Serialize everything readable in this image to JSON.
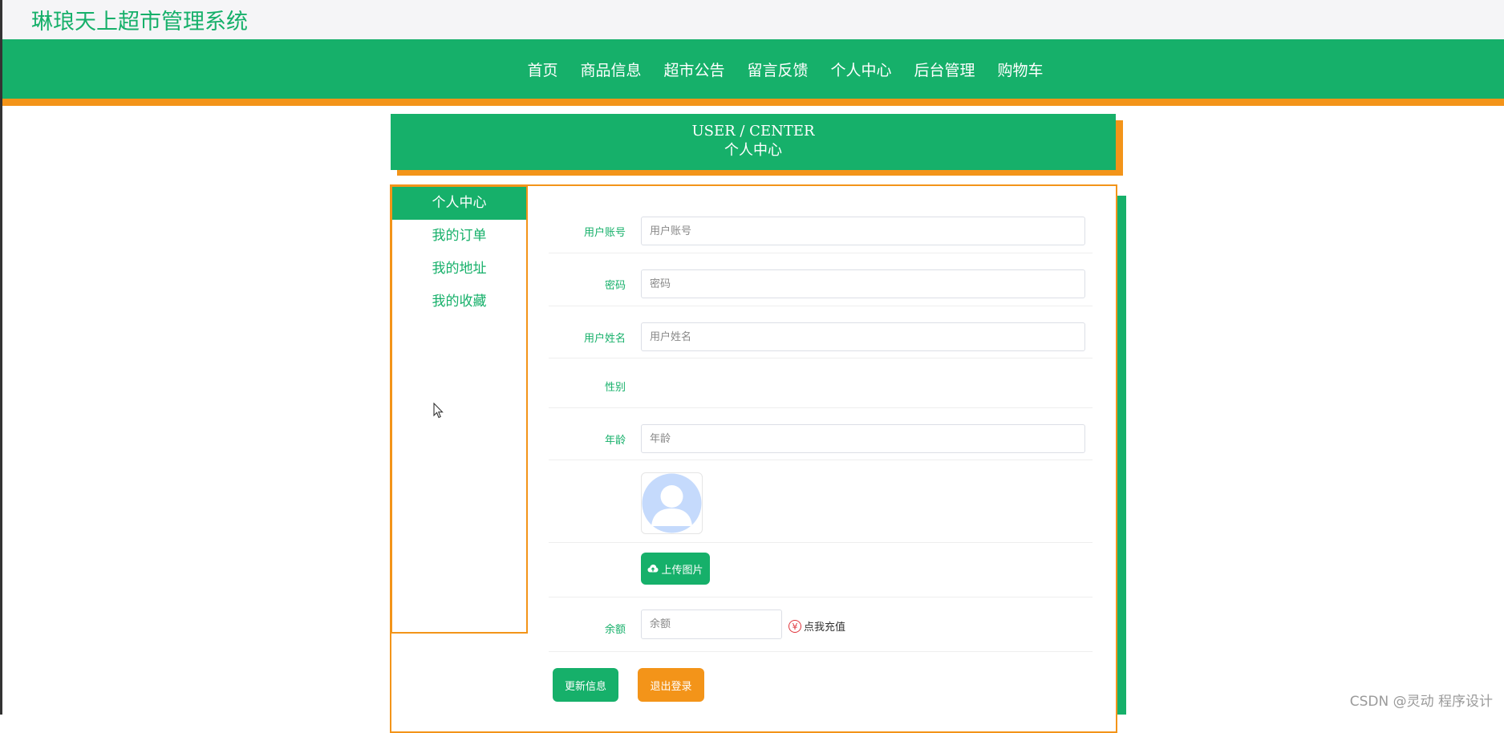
{
  "header": {
    "site_title": "琳琅天上超市管理系统"
  },
  "nav": {
    "items": [
      {
        "label": "首页"
      },
      {
        "label": "商品信息"
      },
      {
        "label": "超市公告"
      },
      {
        "label": "留言反馈"
      },
      {
        "label": "个人中心"
      },
      {
        "label": "后台管理"
      },
      {
        "label": "购物车"
      }
    ]
  },
  "banner": {
    "english": "USER / CENTER",
    "chinese": "个人中心"
  },
  "sidebar": {
    "items": [
      {
        "label": "个人中心",
        "active": true
      },
      {
        "label": "我的订单"
      },
      {
        "label": "我的地址"
      },
      {
        "label": "我的收藏"
      }
    ]
  },
  "form": {
    "account": {
      "label": "用户账号",
      "placeholder": "用户账号",
      "value": ""
    },
    "password": {
      "label": "密码",
      "placeholder": "密码",
      "value": ""
    },
    "name": {
      "label": "用户姓名",
      "placeholder": "用户姓名",
      "value": ""
    },
    "gender": {
      "label": "性别"
    },
    "age": {
      "label": "年龄",
      "placeholder": "年龄",
      "value": ""
    },
    "upload_label": "上传图片",
    "balance": {
      "label": "余额",
      "placeholder": "余额",
      "value": ""
    },
    "recharge_label": "点我充值"
  },
  "buttons": {
    "update": "更新信息",
    "logout": "退出登录"
  },
  "watermark": "CSDN @灵动 程序设计",
  "colors": {
    "primary": "#16b06a",
    "accent": "#f39419",
    "danger": "#e0343b"
  },
  "icons": {
    "upload": "cloud-upload-icon",
    "recharge": "yen-icon",
    "avatar": "user-avatar-icon",
    "cursor": "mouse-cursor-icon"
  }
}
